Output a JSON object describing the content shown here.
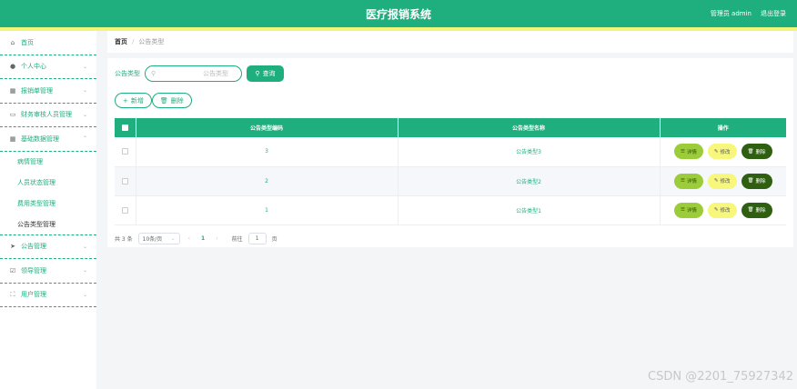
{
  "header": {
    "title": "医疗报销系统",
    "user_label": "管理员 admin",
    "logout": "退出登录"
  },
  "sidebar": {
    "items": [
      {
        "label": "首页",
        "icon": "home-icon",
        "has_chevron": false
      },
      {
        "label": "个人中心",
        "icon": "user-icon",
        "has_chevron": true
      },
      {
        "label": "报销单管理",
        "icon": "calendar-icon",
        "has_chevron": true
      },
      {
        "label": "财务审核人员管理",
        "icon": "monitor-icon",
        "has_chevron": true
      },
      {
        "label": "基础数据管理",
        "icon": "calendar-icon",
        "has_chevron": true
      }
    ],
    "subitems": [
      {
        "label": "病情管理"
      },
      {
        "label": "人员状态管理"
      },
      {
        "label": "费用类型管理"
      },
      {
        "label": "公告类型管理"
      }
    ],
    "items_after": [
      {
        "label": "公告管理",
        "icon": "send-icon",
        "has_chevron": true
      },
      {
        "label": "领导管理",
        "icon": "check-icon",
        "has_chevron": true
      },
      {
        "label": "用户管理",
        "icon": "fullscreen-icon",
        "has_chevron": true
      }
    ]
  },
  "breadcrumb": {
    "home": "首页",
    "separator": "/",
    "current": "公告类型"
  },
  "search": {
    "label": "公告类型",
    "placeholder": "公告类型",
    "button": "查询"
  },
  "actions": {
    "add": "新增",
    "delete": "删除"
  },
  "table": {
    "columns": [
      "公告类型编码",
      "公告类型名称",
      "操作"
    ],
    "rows": [
      {
        "code": "3",
        "name": "公告类型3"
      },
      {
        "code": "2",
        "name": "公告类型2"
      },
      {
        "code": "1",
        "name": "公告类型1"
      }
    ],
    "op_detail": "详情",
    "op_edit": "修改",
    "op_delete": "删除"
  },
  "pagination": {
    "total": "共 3 条",
    "page_size": "10条/页",
    "current_page": "1",
    "goto_label": "前往",
    "goto_value": "1",
    "page_suffix": "页"
  },
  "watermark": "CSDN @2201_75927342",
  "colors": {
    "primary": "#1fae7e",
    "stripe": "#f3f57a",
    "detail": "#9ccc3a",
    "edit": "#f7f77c",
    "delete": "#2f5f10"
  }
}
